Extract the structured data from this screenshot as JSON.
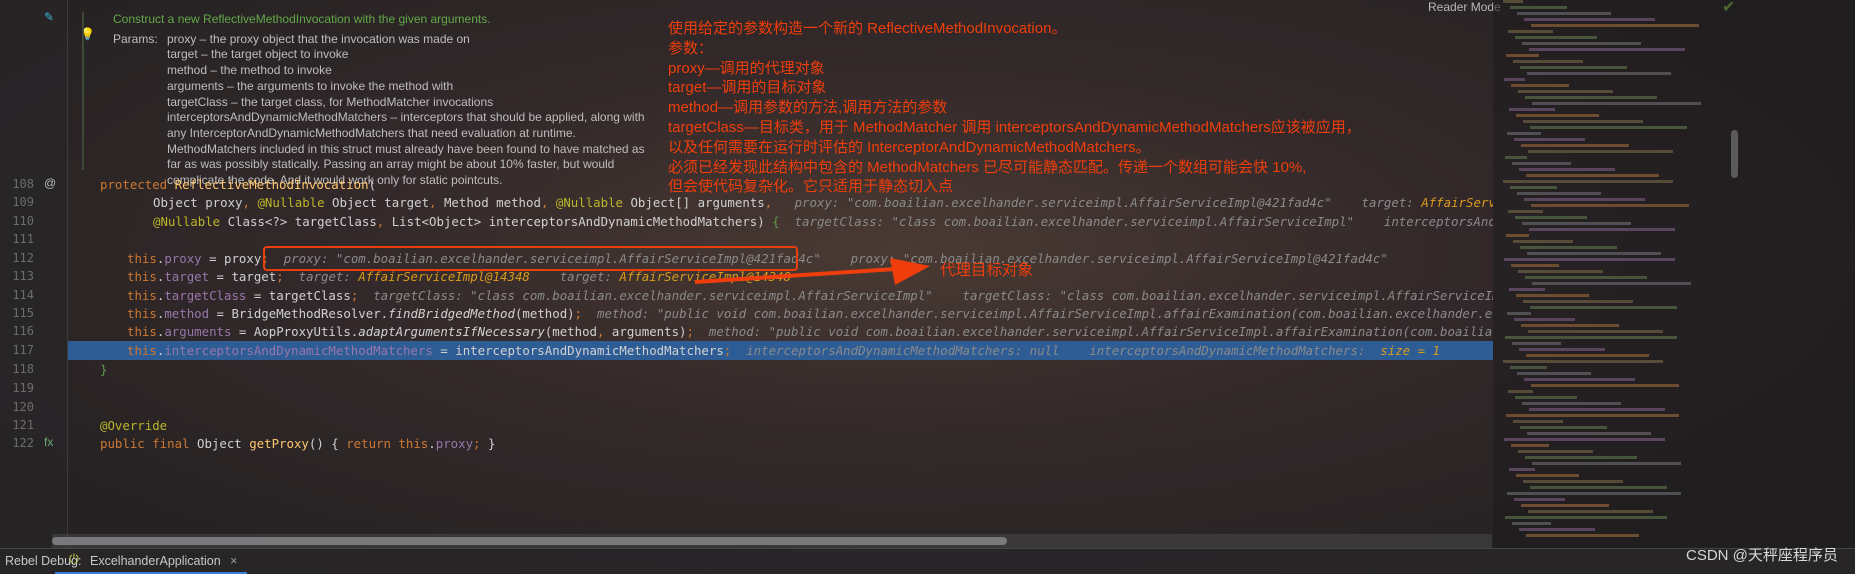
{
  "toolbar": {
    "reader_mode": "Reader Mode",
    "check_icon": "checkmark-icon"
  },
  "doc": {
    "summary": "Construct a new ReflectiveMethodInvocation with the given arguments.",
    "params_label": "Params:",
    "params": [
      "proxy – the proxy object that the invocation was made on",
      "target – the target object to invoke",
      "method – the method to invoke",
      "arguments – the arguments to invoke the method with",
      "targetClass – the target class, for MethodMatcher invocations",
      "interceptorsAndDynamicMethodMatchers – interceptors that should be applied, along with",
      "any InterceptorAndDynamicMethodMatchers that need evaluation at runtime.",
      "MethodMatchers included in this struct must already have been found to have matched as",
      "far as was possibly statically. Passing an array might be about 10% faster, but would",
      "complicate the code. And it would work only for static pointcuts."
    ]
  },
  "annotation": {
    "lines": [
      "使用给定的参数构造一个新的 ReflectiveMethodInvocation。",
      "参数：",
      "proxy—调用的代理对象",
      "target—调用的目标对象",
      "method—调用参数的方法,调用方法的参数",
      "targetClass—目标类，用于 MethodMatcher 调用 interceptorsAndDynamicMethodMatchers应该被应用，",
      "以及任何需要在运行时评估的 InterceptorAndDynamicMethodMatchers。",
      "必须已经发现此结构中包含的 MethodMatchers 已尽可能静态匹配。传递一个数组可能会快 10%,",
      "但会使代码复杂化。它只适用于静态切入点"
    ],
    "arrow_label": "代理目标对象",
    "color": "#ef3e0c"
  },
  "code": {
    "lines": [
      {
        "no": "108",
        "gutter": "@",
        "indent": 100,
        "tokens": [
          [
            "k",
            "protected "
          ],
          [
            "fn",
            "ReflectiveMethodInvocation"
          ],
          [
            "t",
            "("
          ]
        ]
      },
      {
        "no": "109",
        "indent": 153,
        "tokens": [
          [
            "t",
            "Object proxy"
          ],
          [
            "k",
            ", "
          ],
          [
            "a",
            "@Nullable"
          ],
          [
            "t",
            " Object target"
          ],
          [
            "k",
            ", "
          ],
          [
            "t",
            "Method method"
          ],
          [
            "k",
            ", "
          ],
          [
            "a",
            "@Nullable"
          ],
          [
            "t",
            " Object[] arguments"
          ],
          [
            "k",
            ",  "
          ],
          [
            "h",
            " proxy: \"com.boailian.excelhander.serviceimpl.AffairServiceImpl@421fad4c\"    target: "
          ],
          [
            "hv",
            "AffairServiceImpl@14348"
          ],
          [
            "h",
            "    method: \"public void"
          ]
        ]
      },
      {
        "no": "110",
        "indent": 153,
        "tokens": [
          [
            "a",
            "@Nullable"
          ],
          [
            "t",
            " Class<?> targetClass"
          ],
          [
            "k",
            ", "
          ],
          [
            "t",
            "List<Object> interceptorsAndDynamicMethodMatchers) "
          ],
          [
            "g",
            "{"
          ],
          [
            "h",
            "  targetClass: \"class com.boailian.excelhander.serviceimpl.AffairServiceImpl\"    interceptorsAndDynamicMethodMatchers:"
          ]
        ]
      },
      {
        "no": "111",
        "indent": 100,
        "tokens": []
      },
      {
        "no": "112",
        "indent": 127,
        "tokens": [
          [
            "k",
            "this"
          ],
          [
            "t",
            "."
          ],
          [
            "f",
            "proxy"
          ],
          [
            "t",
            " = proxy"
          ],
          [
            "k",
            ";"
          ],
          [
            "h",
            "  proxy: \"com.boailian.excelhander.serviceimpl.AffairServiceImpl@421fad4c\"    proxy: \"com.boailian.excelhander.serviceimpl.AffairServiceImpl@421fad4c\""
          ]
        ]
      },
      {
        "no": "113",
        "indent": 127,
        "tokens": [
          [
            "k",
            "this"
          ],
          [
            "t",
            "."
          ],
          [
            "f",
            "target"
          ],
          [
            "t",
            " = target"
          ],
          [
            "k",
            ";"
          ],
          [
            "h",
            "  target: "
          ],
          [
            "hv",
            "AffairServiceImpl@14348"
          ],
          [
            "h",
            "    target: "
          ],
          [
            "hv",
            "AffairServiceImpl@14348"
          ]
        ]
      },
      {
        "no": "114",
        "indent": 127,
        "tokens": [
          [
            "k",
            "this"
          ],
          [
            "t",
            "."
          ],
          [
            "f",
            "targetClass"
          ],
          [
            "t",
            " = targetClass"
          ],
          [
            "k",
            ";"
          ],
          [
            "h",
            "  targetClass: \"class com.boailian.excelhander.serviceimpl.AffairServiceImpl\"    targetClass: \"class com.boailian.excelhander.serviceimpl.AffairServiceImpl\""
          ]
        ]
      },
      {
        "no": "115",
        "indent": 127,
        "tokens": [
          [
            "k",
            "this"
          ],
          [
            "t",
            "."
          ],
          [
            "f",
            "method"
          ],
          [
            "t",
            " = BridgeMethodResolver."
          ],
          [
            "m",
            "findBridgedMethod"
          ],
          [
            "t",
            "(method)"
          ],
          [
            "k",
            ";"
          ],
          [
            "h",
            "  method: \"public void com.boailian.excelhander.serviceimpl.AffairServiceImpl.affairExamination(com.boailian.excelhander.entity.Affair) throws java"
          ]
        ]
      },
      {
        "no": "116",
        "indent": 127,
        "tokens": [
          [
            "k",
            "this"
          ],
          [
            "t",
            "."
          ],
          [
            "f",
            "arguments"
          ],
          [
            "t",
            " = AopProxyUtils."
          ],
          [
            "m",
            "adaptArgumentsIfNecessary"
          ],
          [
            "t",
            "(method"
          ],
          [
            "k",
            ", "
          ],
          [
            "t",
            "arguments)"
          ],
          [
            "k",
            ";"
          ],
          [
            "h",
            "  method: \"public void com.boailian.excelhander.serviceimpl.AffairServiceImpl.affairExamination(com.boailian.excelhander.entity.Affair"
          ]
        ]
      },
      {
        "no": "117",
        "indent": 127,
        "selected": true,
        "tokens": [
          [
            "k",
            "this"
          ],
          [
            "t",
            "."
          ],
          [
            "f",
            "interceptorsAndDynamicMethodMatchers"
          ],
          [
            "t",
            " = interceptorsAndDynamicMethodMatchers"
          ],
          [
            "k",
            ";"
          ],
          [
            "h",
            "  interceptorsAndDynamicMethodMatchers: null    interceptorsAndDynamicMethodMatchers:  "
          ],
          [
            "hv",
            "size = 1"
          ]
        ]
      },
      {
        "no": "118",
        "indent": 100,
        "tokens": [
          [
            "g",
            "}"
          ]
        ]
      },
      {
        "no": "119",
        "indent": 100,
        "tokens": []
      },
      {
        "no": "120",
        "indent": 100,
        "tokens": []
      },
      {
        "no": "121",
        "indent": 100,
        "tokens": [
          [
            "a",
            "@Override"
          ]
        ]
      },
      {
        "no": "122",
        "gutter": "fx",
        "indent": 100,
        "tokens": [
          [
            "k",
            "public final "
          ],
          [
            "t",
            "Object "
          ],
          [
            "fn",
            "getProxy"
          ],
          [
            "t",
            "() { "
          ],
          [
            "k",
            "return this"
          ],
          [
            "t",
            "."
          ],
          [
            "f",
            "proxy"
          ],
          [
            "k",
            "; "
          ],
          [
            "t",
            "}"
          ]
        ]
      }
    ]
  },
  "bottom": {
    "label": "Rebel Debug:",
    "tab": "ExcelhanderApplication",
    "close": "×"
  },
  "watermark": "CSDN @天秤座程序员"
}
